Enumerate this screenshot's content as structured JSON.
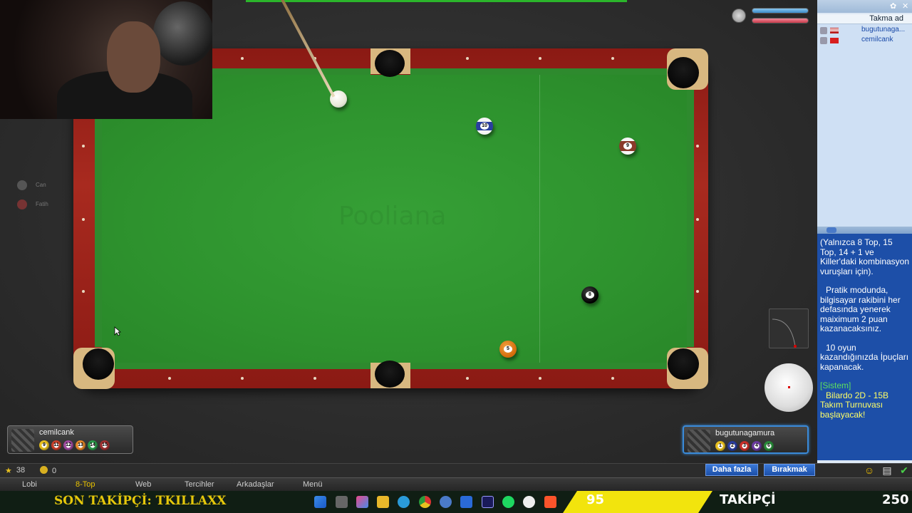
{
  "table": {
    "watermark": "Pooliana"
  },
  "spectators": [
    {
      "name": "Can"
    },
    {
      "name": "Fatih"
    }
  ],
  "players": {
    "left": {
      "name": "cemilcank",
      "balls": [
        "9",
        "11",
        "12",
        "13",
        "14",
        "15"
      ]
    },
    "right": {
      "name": "bugutunagamura",
      "balls": [
        "1",
        "2",
        "3",
        "4",
        "6"
      ]
    }
  },
  "table_balls": [
    "10",
    "9",
    "8",
    "5"
  ],
  "right_panel": {
    "header": "Takma ad",
    "users": [
      {
        "name": "bugutunaga...",
        "flag": "us"
      },
      {
        "name": "cemilcank",
        "flag": "tr"
      }
    ],
    "chat": {
      "message1": "(Yalnızca 8 Top, 15 Top, 14 + 1 ve Killer'daki kombinasyon vuruşları için).",
      "message2": "Pratik modunda, bilgisayar rakibini her defasında yenerek maiximum 2 puan kazanacaksınız.",
      "message3": "10 oyun kazandığınızda İpuçları kapanacak.",
      "system_tag": "[Sistem]",
      "system_message": "Bilardo 2D - 15B Takım Turnuvası başlayacak!"
    }
  },
  "status": {
    "stars": "38",
    "coins": "0",
    "more_button": "Daha fazla",
    "leave_button": "Bırakmak"
  },
  "menu": [
    "Lobi",
    "8-Top",
    "Web",
    "Tercihler",
    "Arkadaşlar",
    "Menü"
  ],
  "menu_active": "8-Top",
  "overlay": {
    "last_follower": "SON TAKİPÇİ: TKILLAXX",
    "follower_count": "95",
    "follower_label": "TAKİPÇİ",
    "follower_goal": "250"
  },
  "colors": {
    "felt": "#2e932e",
    "rail": "#a82a1f",
    "chat_bg": "#1d4fa8",
    "overlay_yellow": "#f2e40d"
  }
}
